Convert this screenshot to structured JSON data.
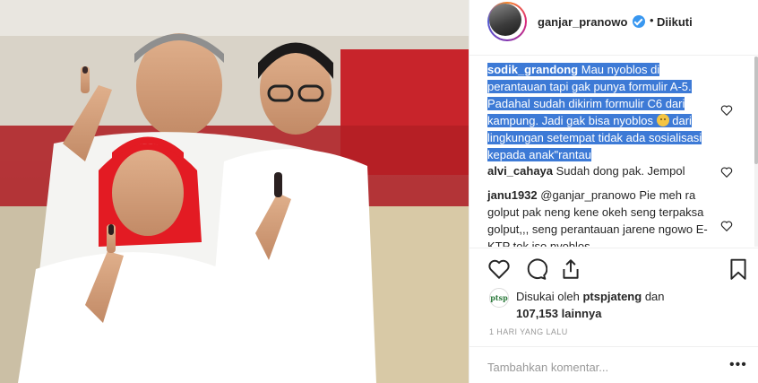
{
  "post": {
    "photo_alt": "Foto kampanye",
    "colors": {
      "accent_red": "#e31b23",
      "selection": "#3d7ad6",
      "verified": "#3897f0"
    }
  },
  "header": {
    "username": "ganjar_pranowo",
    "bullet": "•",
    "follow_status": "Diikuti"
  },
  "comments": [
    {
      "user": "sodik_grandong",
      "text_before_emoji": "Mau nyoblos di perantauan tapi gak punya formulir A-5. Padahal sudah dikirim formulir C6 dari kampung. Jadi gak bisa nyoblos",
      "emoji": "pensive-face",
      "text_after_emoji": "dari lingkungan setempat tidak ada sosialisasi kepada anak\"rantau",
      "selected": true
    },
    {
      "user": "alvi_cahaya",
      "text": "Sudah dong pak. Jempol",
      "selected": false
    },
    {
      "user": "janu1932",
      "text": "@ganjar_pranowo Pie meh ra golput pak neng kene okeh seng terpaksa golput,,, seng perantauan jarene ngowo E-KTP tok iso nyoblos",
      "selected": false
    }
  ],
  "actions": {
    "like": "heart-icon",
    "comment": "comment-icon",
    "share": "share-icon",
    "save": "bookmark-icon"
  },
  "likes": {
    "avatar_text": "ptsp",
    "prefix": "Disukai oleh",
    "liker": "ptspjateng",
    "conjunction": "dan",
    "count": "107,153",
    "suffix": "lainnya"
  },
  "timestamp": "1 HARI YANG LALU",
  "composer": {
    "placeholder": "Tambahkan komentar...",
    "more_label": "•••"
  }
}
